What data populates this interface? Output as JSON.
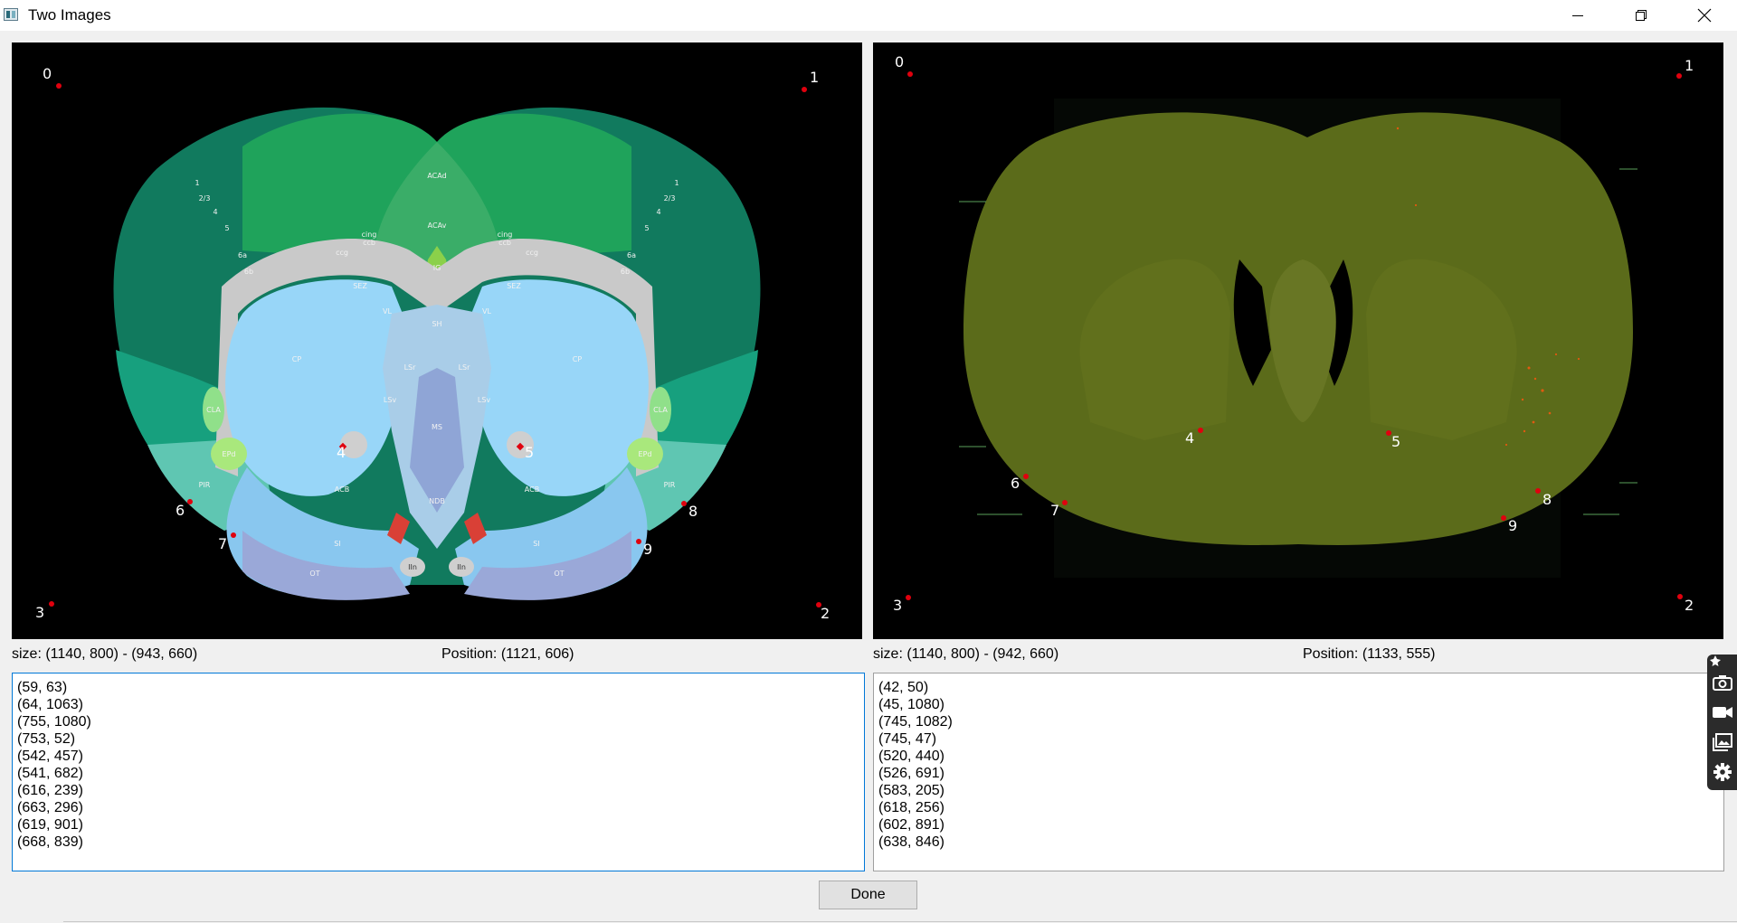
{
  "window": {
    "title": "Two Images"
  },
  "left_panel": {
    "size_text": "size: (1140, 800) - (943, 660)",
    "position_text": "Position: (1121, 606)",
    "point_labels": [
      "0",
      "1",
      "2",
      "3",
      "4",
      "5",
      "6",
      "7",
      "8",
      "9"
    ],
    "points": [
      "(59, 63)",
      "(64, 1063)",
      "(755, 1080)",
      "(753, 52)",
      "(542, 457)",
      "(541, 682)",
      "(616, 239)",
      "(663, 296)",
      "(619, 901)",
      "(668, 839)"
    ],
    "atlas_regions": [
      "1",
      "2/3",
      "4",
      "5",
      "6a",
      "6b",
      "ACAd",
      "ACAv",
      "IG",
      "cing",
      "ccb",
      "ccg",
      "SEZ",
      "VL",
      "SH",
      "CP",
      "LSr",
      "LSv",
      "MS",
      "CLA",
      "EPd",
      "PIR",
      "ACB",
      "NDB",
      "SI",
      "OT",
      "lotd",
      "lfbs",
      "IIn",
      "ccs",
      "MOs",
      "MOp",
      "SSp",
      "AId",
      "AIv",
      "AIp",
      "VISC",
      "GU"
    ]
  },
  "right_panel": {
    "size_text": "size: (1140, 800) - (942, 660)",
    "position_text": "Position: (1133, 555)",
    "point_labels": [
      "0",
      "1",
      "2",
      "3",
      "4",
      "5",
      "6",
      "7",
      "8",
      "9"
    ],
    "points": [
      "(42, 50)",
      "(45, 1080)",
      "(745, 1082)",
      "(745, 47)",
      "(520, 440)",
      "(526, 691)",
      "(583, 205)",
      "(618, 256)",
      "(602, 891)",
      "(638, 846)"
    ]
  },
  "footer": {
    "done_label": "Done"
  },
  "colors": {
    "marker": "#e0000e",
    "cortex_dark": "#117a5e",
    "cortex_light": "#1fa35b",
    "striatum": "#98d6f8",
    "tissue": "#5b6b1a",
    "window_bg": "#f0f0f0"
  },
  "icons": [
    "app-icon",
    "minimize-icon",
    "restore-icon",
    "close-icon",
    "pin-icon",
    "camera-icon",
    "video-icon",
    "gallery-icon",
    "gear-icon"
  ]
}
